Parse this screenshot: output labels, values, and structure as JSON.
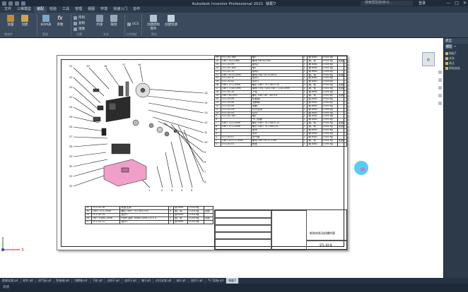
{
  "window": {
    "title": "Autodesk Inventor Professional 2021",
    "doc_name": "装配7",
    "search_placeholder": "搜索帮助和命令...",
    "user": "登录"
  },
  "menu_tabs": [
    "文件",
    "三维模型",
    "装配",
    "检验",
    "工具",
    "管理",
    "视图",
    "环境",
    "快速入门",
    "协作"
  ],
  "active_menu": 2,
  "ribbon": {
    "buttons": [
      "放置",
      "创建",
      "BOM表",
      "参数",
      "阵列",
      "复制",
      "镜像",
      "约束",
      "联接",
      "UCS",
      "创建结构零件",
      "创建资源"
    ],
    "groups": [
      "零部件",
      "管理",
      "位置",
      "关系",
      "工作特征",
      "简化"
    ]
  },
  "bom_top": [
    [
      "26",
      "STL-02-15B",
      "轴2",
      "1",
      "钢 6061",
      "0.001 kg",
      ""
    ],
    [
      "25",
      "GB/T 923-1988",
      "螺母 GB 923 M3",
      "2",
      "钢、软",
      "0.001 kg",
      "无图"
    ],
    [
      "24",
      "STL-02-09",
      "齿轮2",
      "1",
      "钢 6061",
      "0.004 kg",
      ""
    ],
    [
      "23",
      "STL-02-15A",
      "轴1",
      "1",
      "钢 6061",
      "0.001 kg",
      ""
    ],
    [
      "22",
      "STL-02-12",
      "齿轮1",
      "1",
      "钢 6061",
      "0.004 kg",
      ""
    ],
    [
      "21",
      "GB/T 6174-2000",
      "螺母 GB/T 6174 M3.5",
      "1",
      "钢、软",
      "0.000 kg",
      "无图"
    ],
    [
      "20",
      "STL-02-11",
      "连杆1",
      "1",
      "钢 6061",
      "0.001 kg",
      ""
    ],
    [
      "19",
      "STL-02-02",
      "连杆2",
      "1",
      "钢 6061",
      "0.004 kg",
      ""
    ],
    [
      "18",
      "GB/T 70.1-2008",
      "螺钉 GB/T 70.1 M3 x 10",
      "4",
      "钢、软",
      "0.002 kg",
      "无图"
    ],
    [
      "17",
      "GB/T 7218-1995",
      "轴承 FSN 718/4 GB/T 7218-1995",
      "2",
      "钢、软",
      "0.001 kg",
      "无图"
    ],
    [
      "16",
      "STL-02-10",
      "下轮",
      "1",
      "钢 6061",
      "0.001 kg",
      ""
    ],
    [
      "15",
      "GB/T 80-2007",
      "螺钉 GB/T 80 - M3 x 6",
      "1",
      "钢、软",
      "0.000 kg",
      "无图"
    ],
    [
      "14",
      "STL-02-05",
      "防板轴",
      "1",
      "钢 6061",
      "0.002 kg",
      ""
    ],
    [
      "13",
      "STL-02-06",
      "浅鋼轴",
      "1",
      "钢 6061",
      "0.003 kg",
      ""
    ],
    [
      "12",
      "STL-02-05",
      "浅鋼",
      "1",
      "钢 6061",
      "0.001 kg",
      ""
    ],
    [
      "11",
      "STL-02-03",
      "幻闪支架",
      "1",
      "钢 6061",
      "0.009 kg",
      ""
    ],
    [
      "10",
      "STL-02-04",
      "幻闪",
      "1",
      "钢 6061",
      "0.001 kg",
      ""
    ],
    [
      "9",
      "STL-02-15C",
      "轴3",
      "1",
      "钢 6061",
      "0.001 kg",
      ""
    ],
    [
      "8",
      "",
      "气门挡板",
      "1",
      "钢 6061",
      "0.001 kg",
      ""
    ],
    [
      "7",
      "GB/T 70.1-2008",
      "螺钉 GB/T 70.1 M5 x 12",
      "2",
      "钢、软",
      "0.001 kg",
      "无图"
    ],
    [
      "6",
      "GB/T 70.1-2008",
      "螺钉 GB/T 70.1 M5 x 8",
      "1",
      "钢、软",
      "0.001 kg",
      "无图"
    ],
    [
      "5",
      "",
      "垫块",
      "1",
      "钢 6061",
      "0.001 kg",
      ""
    ],
    [
      "4",
      "",
      "连杆",
      "1",
      "钢 6061",
      "0.001 kg",
      ""
    ],
    [
      "3",
      "STL-02-07",
      "进气板",
      "1",
      "钢 6061",
      "0.002 kg",
      ""
    ],
    [
      "2",
      "GB/T 6172.1-2000",
      "螺母 GB/T 6172.1 M4",
      "1",
      "钢、软",
      "0.001 kg",
      "无图"
    ],
    [
      "1",
      "STL-02-01",
      "底座",
      "1",
      "钢 6061",
      "0.191 kg",
      ""
    ]
  ],
  "bom_bottom": [
    [
      "32",
      "STL-02-16",
      "底座支架",
      "1",
      "钢 6061",
      "0.016 kg",
      ""
    ],
    [
      "30",
      "GB/T 70.1-2008",
      "螺钉 GB/T 70.1 M3 x 10",
      "4",
      "钢、软",
      "0.001 kg",
      "无图"
    ],
    [
      "29",
      "STL-02-14",
      "连杆3",
      "1",
      "钢 6061",
      "0.001 kg",
      ""
    ],
    [
      "28",
      "JB/T 10582-2006",
      "Rod0 油杆 10582-2006-2.5 X 4",
      "1",
      "钢、软",
      "0.000 kg",
      "无图"
    ],
    [
      "27",
      "STL-02-13",
      "连杆2",
      "1",
      "钢 6061",
      "0.001 kg",
      ""
    ]
  ],
  "title_block": {
    "drawing_name": "新势材发动机爆炸图",
    "drawing_no": "STL-02-B"
  },
  "callouts": [
    "21",
    "19",
    "18",
    "17",
    "16",
    "22",
    "23",
    "20",
    "24",
    "25",
    "26",
    "27",
    "28",
    "29",
    "30",
    "31",
    "32",
    "1",
    "2",
    "3",
    "4",
    "5",
    "6",
    "7",
    "8",
    "9",
    "10",
    "11",
    "12",
    "13",
    "14",
    "15"
  ],
  "view_cube_label": "前",
  "browser_panel": {
    "header": "模型",
    "tabs": [
      "模型",
      "+"
    ],
    "items": [
      "装配7",
      "关系",
      "表达",
      "原始坐标"
    ]
  },
  "doc_tabs": [
    "底座支架.ipt",
    "轮杆.ipt",
    "进气板.ipt",
    "防板轴.ipt",
    "浅鋼轴.ipt",
    "下轮.ipt",
    "连杆2.ipt",
    "连杆3.ipt",
    "轴3.ipt",
    "幻闪支架.ipt",
    "轴2.ipt",
    "连杆1.ipt",
    "气门挡板.ipt",
    "装配7"
  ],
  "active_doc_tab": 13,
  "status": "就绪"
}
